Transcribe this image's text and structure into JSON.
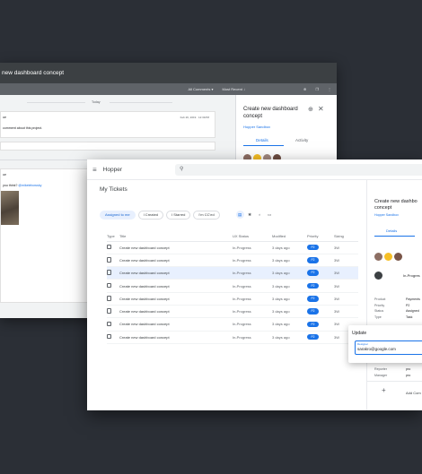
{
  "colors": {
    "accent": "#1a73e8",
    "background": "#2b2f36",
    "titlebar": "#3c4043"
  },
  "back": {
    "window_title": "new dashboard concept",
    "comments_filter": "All Comments",
    "sort": "Most Recent",
    "today": "Today",
    "thread": {
      "header": "ue",
      "timestamp": "Feb 26, 2019 · 12:31PM",
      "comment": "comment about this project."
    },
    "reply": {
      "header": "ue",
      "question": "you think?",
      "mention": "@mikelebowsky"
    },
    "panel": {
      "title": "Create new dashboard concept",
      "link": "Hopper Sandbox",
      "tabs": [
        "Details",
        "Activity"
      ]
    }
  },
  "front": {
    "app_name": "Hopper",
    "heading": "My Tickets",
    "filters": [
      {
        "label": "Assigned to me",
        "active": true
      },
      {
        "label": "I Created",
        "active": false
      },
      {
        "label": "I Starred",
        "active": false
      },
      {
        "label": "I'm CC'ed",
        "active": false
      }
    ],
    "icons": [
      "doc-icon",
      "bug-icon",
      "lightbulb-icon",
      "chat-icon"
    ],
    "table": {
      "headers": [
        "Type",
        "Title",
        "UX Status",
        "Modified",
        "Priority",
        "Sizing"
      ],
      "rows": [
        {
          "title": "Create new dashboard concept",
          "status": "In-Progress",
          "modified": "3 days ago",
          "priority": "P2",
          "size": "3W"
        },
        {
          "title": "Create new dashboard concept",
          "status": "In-Progress",
          "modified": "3 days ago",
          "priority": "P2",
          "size": "3W"
        },
        {
          "title": "Create new dashboard concept",
          "status": "In-Progress",
          "modified": "3 days ago",
          "priority": "P2",
          "size": "3W"
        },
        {
          "title": "Create new dashboard concept",
          "status": "In-Progress",
          "modified": "3 days ago",
          "priority": "P2",
          "size": "3W"
        },
        {
          "title": "Create new dashboard concept",
          "status": "In-Progress",
          "modified": "3 days ago",
          "priority": "P2",
          "size": "3W"
        },
        {
          "title": "Create new dashboard concept",
          "status": "In-Progress",
          "modified": "3 days ago",
          "priority": "P2",
          "size": "3W"
        },
        {
          "title": "Create new dashboard concept",
          "status": "In-Progress",
          "modified": "3 days ago",
          "priority": "P2",
          "size": "3W"
        },
        {
          "title": "Create new dashboard concept",
          "status": "In-Progress",
          "modified": "3 days ago",
          "priority": "P2",
          "size": "3W"
        }
      ]
    },
    "side": {
      "title": "Create new dashbo concept",
      "link": "Hopper Sandbox",
      "tab": "Details",
      "status": "In-Progres",
      "props": [
        {
          "k": "Product",
          "v": "Payments"
        },
        {
          "k": "Priority",
          "v": "P2"
        },
        {
          "k": "Status",
          "v": "Assigned"
        },
        {
          "k": "Type",
          "v": "Task"
        }
      ],
      "props2": [
        {
          "k": "Reporter",
          "v": "pro"
        },
        {
          "k": "Manager",
          "v": "pro"
        }
      ],
      "add": "Add Com"
    },
    "update": {
      "title": "Update",
      "field_label": "Designer",
      "field_value": "sarakro@google.com"
    }
  }
}
